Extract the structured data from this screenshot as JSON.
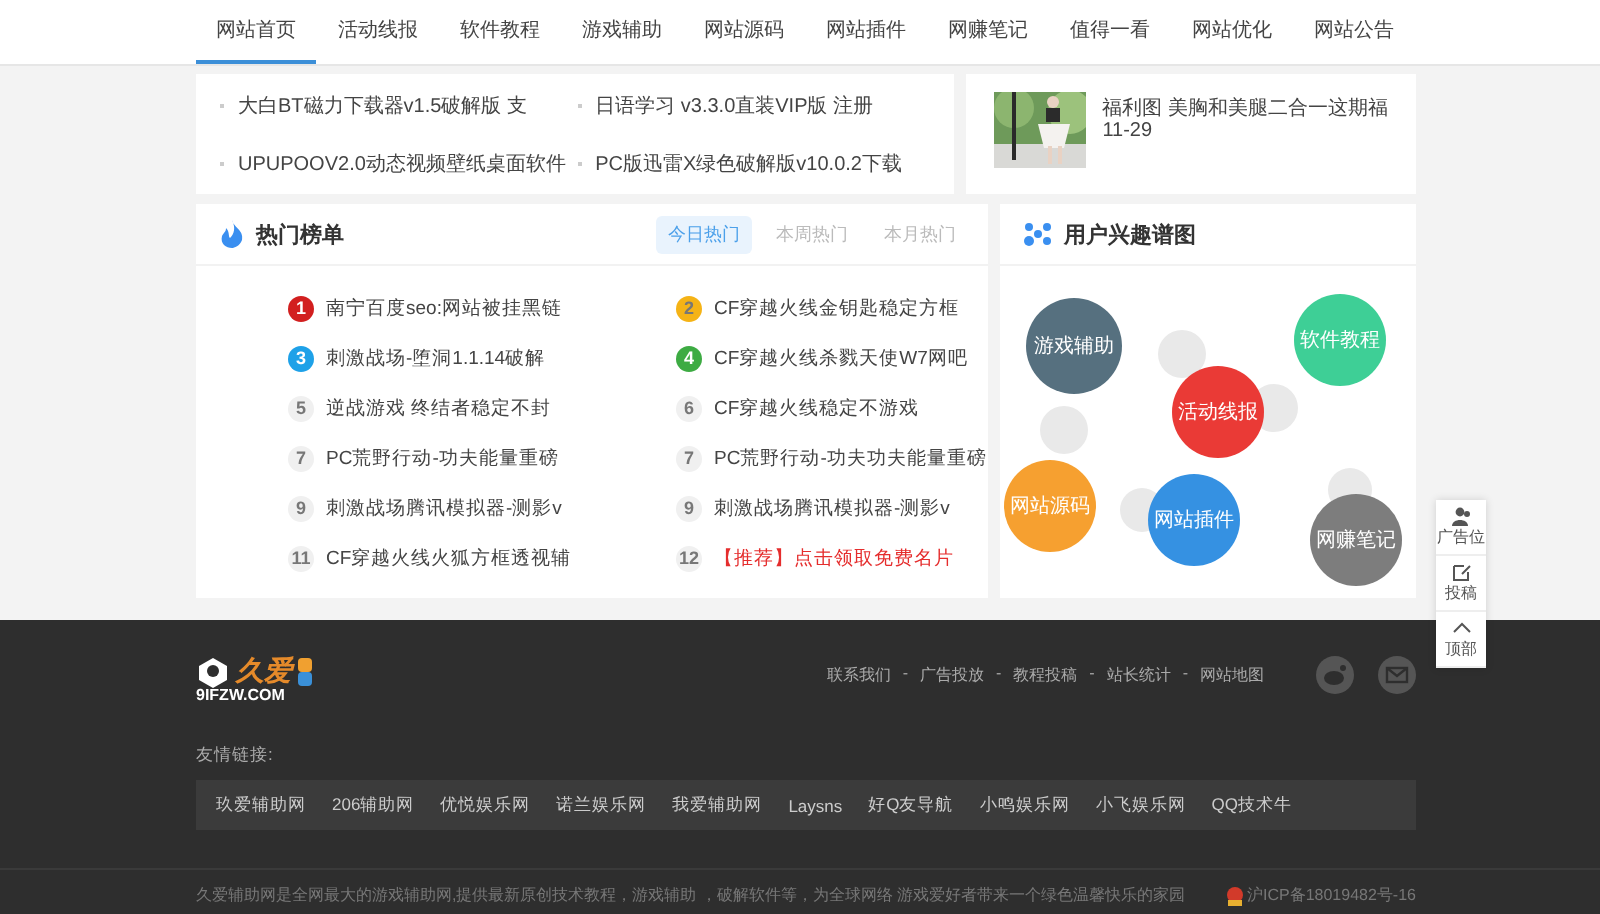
{
  "nav": [
    {
      "label": "网站首页",
      "selected": true
    },
    {
      "label": "活动线报",
      "selected": false
    },
    {
      "label": "软件教程",
      "selected": false
    },
    {
      "label": "游戏辅助",
      "selected": false
    },
    {
      "label": "网站源码",
      "selected": false
    },
    {
      "label": "网站插件",
      "selected": false
    },
    {
      "label": "网赚笔记",
      "selected": false
    },
    {
      "label": "值得一看",
      "selected": false
    },
    {
      "label": "网站优化",
      "selected": false
    },
    {
      "label": "网站公告",
      "selected": false
    }
  ],
  "latest": [
    {
      "title": "大白BT磁力下载器v1.5破解版 支"
    },
    {
      "title": "日语学习 v3.3.0直装VIP版 注册"
    },
    {
      "title": "UPUPOOV2.0动态视频壁纸桌面软件"
    },
    {
      "title": "PC版迅雷X绿色破解版v10.0.2下载"
    }
  ],
  "featured": {
    "kind": "picture",
    "title": "福利图 美胸和美腿二合一这期福",
    "date": "11-29"
  },
  "hot": {
    "title": "热门榜单",
    "tabs": [
      {
        "label": "今日热门",
        "selected": true
      },
      {
        "label": "本周热门",
        "selected": false
      },
      {
        "label": "本月热门",
        "selected": false
      }
    ],
    "items": [
      {
        "rank": "1",
        "color": "#d21f1f",
        "title": "南宁百度seo:网站被挂黑链",
        "highlight": false
      },
      {
        "rank": "2",
        "color": "#f5b316",
        "title": "CF穿越火线金钥匙稳定方框",
        "highlight": false
      },
      {
        "rank": "3",
        "color": "#1ea1e8",
        "title": "刺激战场-堕洞1.1.14破解",
        "highlight": false
      },
      {
        "rank": "4",
        "color": "#3dab43",
        "title": "CF穿越火线杀戮天使W7网吧",
        "highlight": false
      },
      {
        "rank": "5",
        "color": "#f0f0f0",
        "title": "逆战游戏 终结者稳定不封",
        "highlight": false
      },
      {
        "rank": "6",
        "color": "#f0f0f0",
        "title": "CF穿越火线稳定不游戏",
        "highlight": false
      },
      {
        "rank": "7",
        "color": "#f0f0f0",
        "title": "PC荒野行动-功夫能量重磅",
        "highlight": false
      },
      {
        "rank": "7",
        "color": "#f0f0f0",
        "title": "PC荒野行动-功夫功夫能量重磅",
        "highlight": false
      },
      {
        "rank": "9",
        "color": "#f0f0f0",
        "title": "刺激战场腾讯模拟器-测影v",
        "highlight": false
      },
      {
        "rank": "9",
        "color": "#f0f0f0",
        "title": "刺激战场腾讯模拟器-测影v",
        "highlight": false
      },
      {
        "rank": "11",
        "color": "#f0f0f0",
        "title": "CF穿越火线火狐方框透视辅",
        "highlight": false
      },
      {
        "rank": "12",
        "color": "#f0f0f0",
        "title": "【推荐】点击领取免费名片",
        "highlight": true
      }
    ]
  },
  "interest": {
    "title": "用户兴趣谱图",
    "bubbles": [
      {
        "label": "游戏辅助",
        "color": "#56707f"
      },
      {
        "label": "软件教程",
        "color": "#3ecf96"
      },
      {
        "label": "活动线报",
        "color": "#ea3a36"
      },
      {
        "label": "网站源码",
        "color": "#f6a030"
      },
      {
        "label": "网站插件",
        "color": "#3591e2"
      },
      {
        "label": "网赚笔记",
        "color": "#7d7d7d"
      }
    ]
  },
  "side_tools": [
    {
      "label": "广告位"
    },
    {
      "label": "投稿"
    },
    {
      "label": "顶部"
    }
  ],
  "footer": {
    "logo_text": "久爱",
    "logo_domain": "9IFZW.COM",
    "links": [
      "联系我们",
      "广告投放",
      "教程投稿",
      "站长统计",
      "网站地图"
    ],
    "separator": "-",
    "friends_label": "友情链接:",
    "friends": [
      "玖爱辅助网",
      "206辅助网",
      "优悦娱乐网",
      "诺兰娱乐网",
      "我爱辅助网",
      "Laysns",
      "好Q友导航",
      "小鸣娱乐网",
      "小飞娱乐网",
      "QQ技术牛"
    ],
    "copyright": "久爱辅助网是全网最大的游戏辅助网,提供最新原创技术教程，游戏辅助 ，破解软件等，为全球网络 游戏爱好者带来一个绿色温馨快乐的家园",
    "icp": "沪ICP备18019482号-16"
  }
}
